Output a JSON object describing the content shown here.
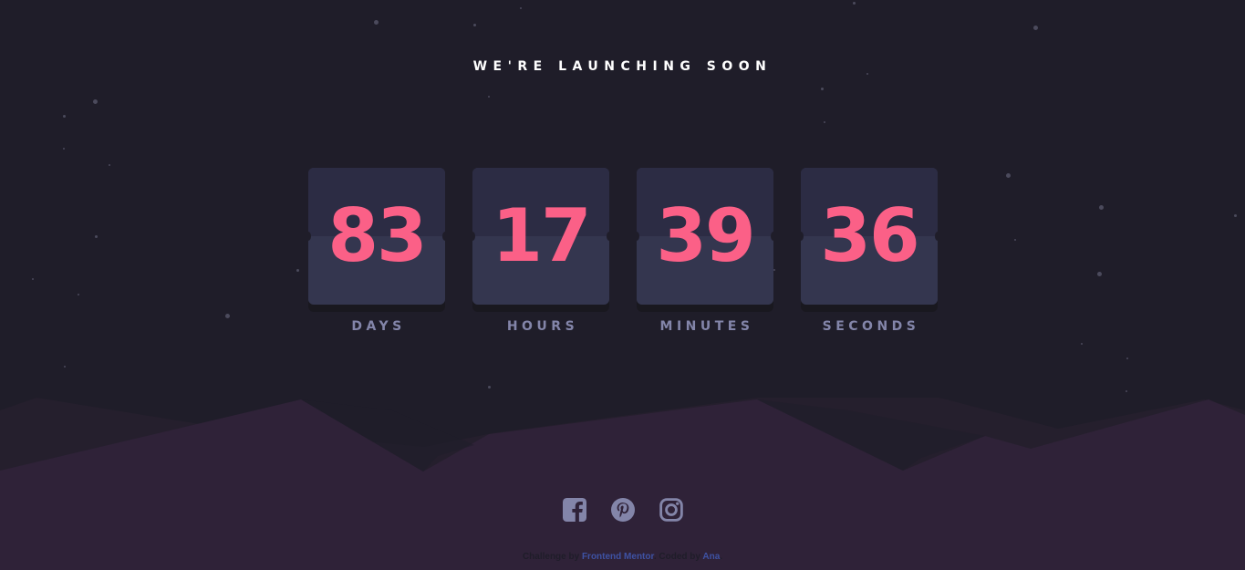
{
  "title": "WE'RE LAUNCHING SOON",
  "countdown": [
    {
      "value": "83",
      "label": "DAYS"
    },
    {
      "value": "17",
      "label": "HOURS"
    },
    {
      "value": "39",
      "label": "MINUTES"
    },
    {
      "value": "36",
      "label": "SECONDS"
    }
  ],
  "social": [
    {
      "name": "facebook-icon"
    },
    {
      "name": "pinterest-icon"
    },
    {
      "name": "instagram-icon"
    }
  ],
  "attribution": {
    "prefix": "Challenge by ",
    "link1": "Frontend Mentor",
    "middle": ". Coded by ",
    "link2": "Ana",
    "suffix": "."
  },
  "colors": {
    "background": "#1f1d29",
    "card": "#34364f",
    "number": "#fb6087",
    "label": "#8385a9",
    "hills": "#2f2238",
    "link": "#3e52a3"
  }
}
